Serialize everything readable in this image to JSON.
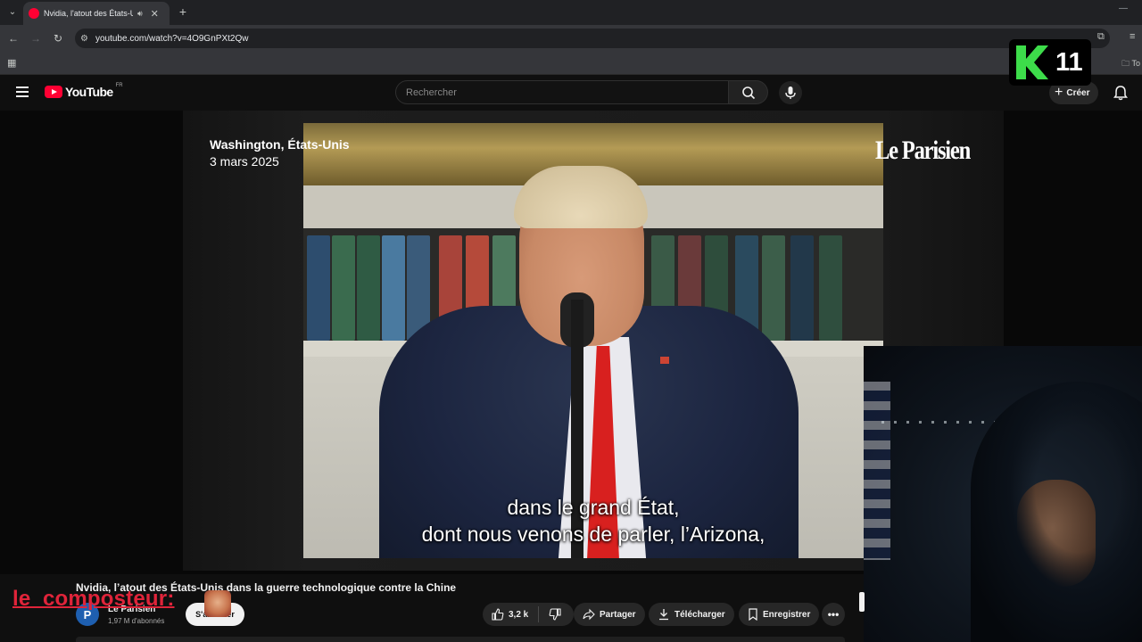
{
  "browser": {
    "tab_title": "Nvidia, l'atout des États-Unis dans la guerre technologique contre la Chine",
    "url": "youtube.com/watch?v=4O9GnPXt2Qw"
  },
  "youtube": {
    "logo_text": "YouTube",
    "region": "FR",
    "search_placeholder": "Rechercher",
    "create_label": "Créer"
  },
  "video": {
    "location": "Washington, États-Unis",
    "date": "3 mars 2025",
    "brand": "Le Parisien",
    "subtitle_line1": "dans le grand État,",
    "subtitle_line2": "dont nous venons de parler, l’Arizona,",
    "title": "Nvidia, l’atout des États-Unis dans la guerre technologique contre la Chine",
    "channel_name": "Le Parisien",
    "channel_initial": "P",
    "subscribers": "1,97 M d'abonnés",
    "subscribe_label": "S'abonner",
    "likes": "3,2 k",
    "share_label": "Partager",
    "download_label": "Télécharger",
    "save_label": "Enregistrer"
  },
  "overlay": {
    "streamer_name": "le_composteur:",
    "badge_number": "11",
    "colors": {
      "name": "#e0243a",
      "badge_k": "#3ddc4a"
    }
  },
  "colors": {
    "yt_red": "#ff0033",
    "background": "#0f0f0f",
    "pill": "#272727",
    "tie": "#d8201f"
  }
}
